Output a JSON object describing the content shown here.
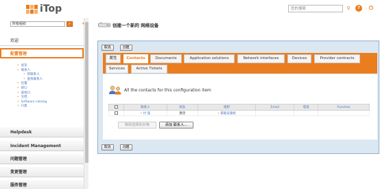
{
  "header": {
    "logo_text": "iTop",
    "search_placeholder": "您的搜索",
    "icons": [
      "search-icon",
      "help-icon",
      "power-icon"
    ],
    "accent_color": "#ea7d1e"
  },
  "sidebar": {
    "org_select": "所有组织",
    "menus": [
      {
        "label": "欢迎"
      },
      {
        "label": "配置管理",
        "active": true
      },
      {
        "label": "Helpdesk"
      },
      {
        "label": "Incident Management"
      },
      {
        "label": "问题管理"
      },
      {
        "label": "变更管理"
      },
      {
        "label": "服务管理"
      }
    ],
    "config_items": [
      {
        "label": "总览",
        "indent": false
      },
      {
        "label": "联系人",
        "indent": false
      },
      {
        "label": "新联系人",
        "indent": true
      },
      {
        "label": "查找联系人",
        "indent": true
      },
      {
        "label": "位置",
        "indent": false
      },
      {
        "label": "新CI",
        "indent": false
      },
      {
        "label": "查找CI",
        "indent": false
      },
      {
        "label": "文档",
        "indent": false
      },
      {
        "label": "Software catalog",
        "indent": false
      },
      {
        "label": "CI类",
        "indent": false
      }
    ]
  },
  "main": {
    "page_title": "创建一个新的 网络设备",
    "cancel_label": "取消",
    "create_label": "创建",
    "tabs_row1": [
      "属性",
      "Contacts",
      "Documents",
      "Application solutions",
      "Network interfaces",
      "Devices",
      "Provider contracts"
    ],
    "tabs_row2": [
      "Services",
      "Active Tickets"
    ],
    "active_tab": "Contacts",
    "contacts_heading": "All the contacts for this configuration item",
    "table": {
      "columns": [
        "联系人",
        "状态",
        "组织",
        "Email",
        "电话",
        "Function"
      ],
      "rows": [
        {
          "contact": "付 强",
          "status": "激活",
          "org": "基础设施组",
          "email": "",
          "phone": "",
          "function": ""
        }
      ]
    },
    "remove_label": "移除选择的对象",
    "add_label": "添加 联系人..."
  }
}
